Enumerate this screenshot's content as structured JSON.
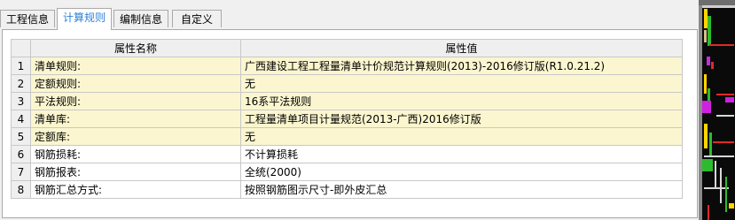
{
  "tabs": [
    {
      "label": "工程信息",
      "active": false
    },
    {
      "label": "计算规则",
      "active": true
    },
    {
      "label": "编制信息",
      "active": false
    },
    {
      "label": "自定义",
      "active": false
    }
  ],
  "table": {
    "headers": {
      "name": "属性名称",
      "value": "属性值"
    },
    "rows": [
      {
        "num": "1",
        "name": "清单规则:",
        "value": "广西建设工程工程量清单计价规范计算规则(2013)-2016修订版(R1.0.21.2)"
      },
      {
        "num": "2",
        "name": "定额规则:",
        "value": "无"
      },
      {
        "num": "3",
        "name": "平法规则:",
        "value": "16系平法规则"
      },
      {
        "num": "4",
        "name": "清单库:",
        "value": "工程量清单项目计量规范(2013-广西)2016修订版"
      },
      {
        "num": "5",
        "name": "定额库:",
        "value": "无"
      },
      {
        "num": "6",
        "name": "钢筋损耗:",
        "value": "不计算损耗"
      },
      {
        "num": "7",
        "name": "钢筋报表:",
        "value": "全统(2000)"
      },
      {
        "num": "8",
        "name": "钢筋汇总方式:",
        "value": "按照钢筋图示尺寸-即外皮汇总"
      }
    ]
  },
  "colors": {
    "active_tab_text": "#2d7fd6",
    "row_highlight": "#fbf6cf",
    "header_bg": "#efefef"
  }
}
